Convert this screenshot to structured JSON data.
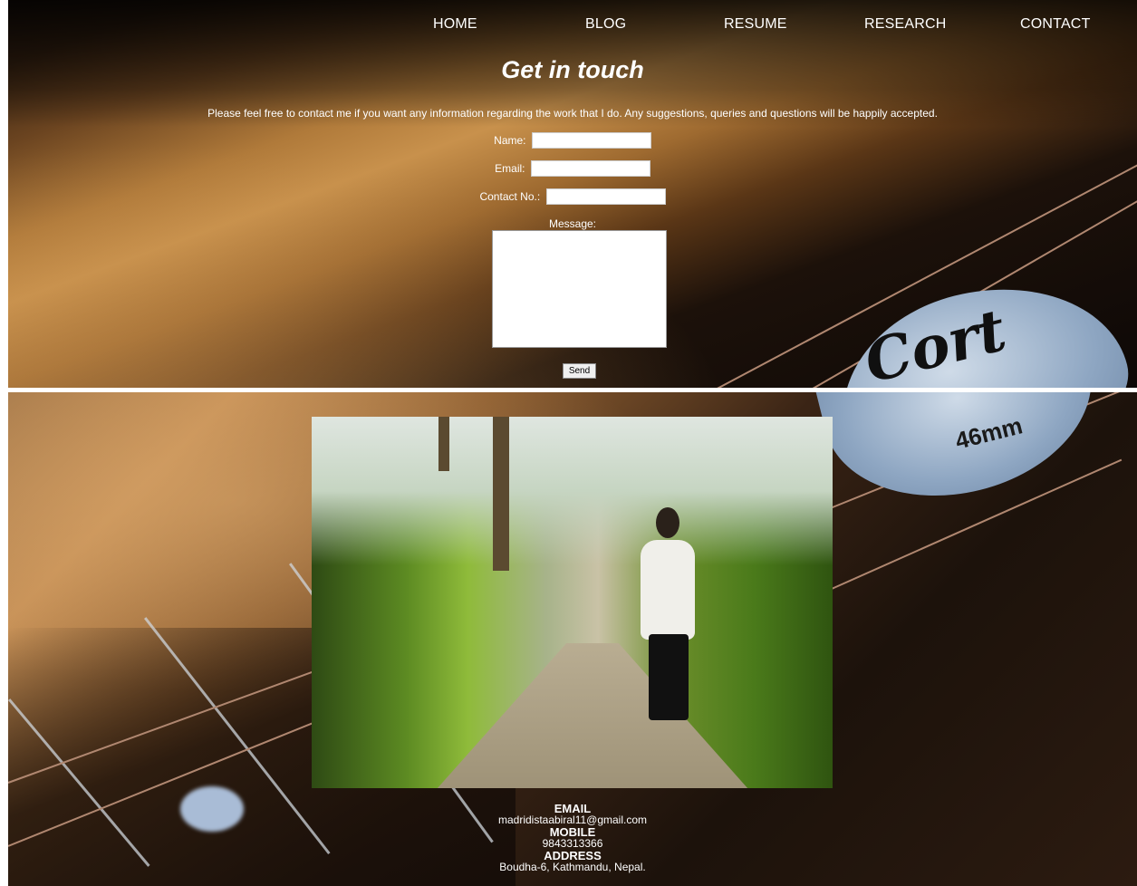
{
  "nav": {
    "items": [
      {
        "label": "HOME"
      },
      {
        "label": "BLOG"
      },
      {
        "label": "RESUME"
      },
      {
        "label": "RESEARCH"
      },
      {
        "label": "CONTACT"
      }
    ]
  },
  "header": {
    "title": "Get in touch"
  },
  "intro": "Please feel free to contact me if you want any information regarding the work that I do. Any suggestions, queries and questions will be happily accepted.",
  "form": {
    "name_label": "Name:",
    "name_value": "",
    "email_label": "Email:",
    "email_value": "",
    "contact_label": "Contact No.:",
    "contact_value": "",
    "message_label": "Message:",
    "message_value": "",
    "send_label": "Send"
  },
  "contact": {
    "email_heading": "EMAIL",
    "email": "madridistaabiral11@gmail.com",
    "mobile_heading": "MOBILE",
    "mobile": "9843313366",
    "address_heading": "ADDRESS",
    "address": "Boudha-6, Kathmandu, Nepal."
  },
  "background": {
    "pick_text": "Cort",
    "pick_thickness": "46mm"
  }
}
